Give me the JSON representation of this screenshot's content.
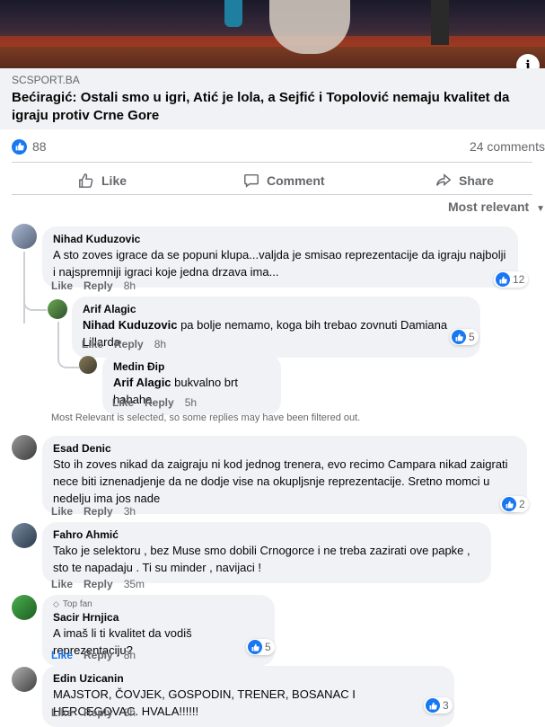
{
  "post": {
    "source": "SCSPORT.BA",
    "headline": "Bećiragić: Ostali smo u igri, Atić je lola, a Sejfić i Topolović nemaju kvalitet da igraju protiv Crne Gore",
    "reactions_count": "88",
    "comments_count": "24 comments"
  },
  "actions": {
    "like": "Like",
    "comment": "Comment",
    "share": "Share"
  },
  "sort_label": "Most relevant",
  "filter_note": "Most Relevant is selected, so some replies may have been filtered out.",
  "comments": [
    {
      "author": "Nihad Kuduzovic",
      "text": "A sto zoves igrace da se popuni klupa...valjda je smisao reprezentacije da igraju najbolji i najspremniji igraci koje jedna drzava ima...",
      "like": "Like",
      "reply": "Reply",
      "time": "8h",
      "reactions": "12"
    },
    {
      "author": "Arif Alagic",
      "mention": "Nihad Kuduzovic",
      "text": " pa bolje nemamo, koga bih trebao zovnuti Damiana Lillarda",
      "like": "Like",
      "reply": "Reply",
      "time": "8h",
      "reactions": "5"
    },
    {
      "author": "Medin Đip",
      "mention": "Arif Alagic",
      "text": " bukvalno brt hahaha",
      "like": "Like",
      "reply": "Reply",
      "time": "5h"
    },
    {
      "author": "Esad Denic",
      "text": "Sto ih zoves nikad da zaigraju ni kod jednog trenera, evo recimo Campara nikad zaigrati nece biti iznenadjenje da ne dodje vise na okupljsnje reprezentacije. Sretno momci u nedelju ima jos nade",
      "like": "Like",
      "reply": "Reply",
      "time": "3h",
      "reactions": "2"
    },
    {
      "author": "Fahro Ahmić",
      "text": "Tako je selektoru , bez Muse smo dobili Crnogorce i ne treba zazirati ove papke , sto te napadaju . Ti su minder , navijaci !",
      "like": "Like",
      "reply": "Reply",
      "time": "35m"
    },
    {
      "badge": "Top fan",
      "author": "Sacir Hrnjica",
      "text": "A imaš li ti kvalitet da vodiš reprezentaciju?",
      "like": "Like",
      "reply": "Reply",
      "time": "8h",
      "reactions": "5"
    },
    {
      "author": "Edin Uzicanin",
      "text": "MAJSTOR, ČOVJEK, GOSPODIN, TRENER, BOSANAC I HERCEGOVAC. HVALA!!!!!!",
      "like": "Like",
      "reply": "Reply",
      "time": "8h",
      "reactions": "3"
    }
  ],
  "colors": {
    "accent": "#1877f2",
    "bubble": "#f0f2f5",
    "muted": "#65676b"
  }
}
